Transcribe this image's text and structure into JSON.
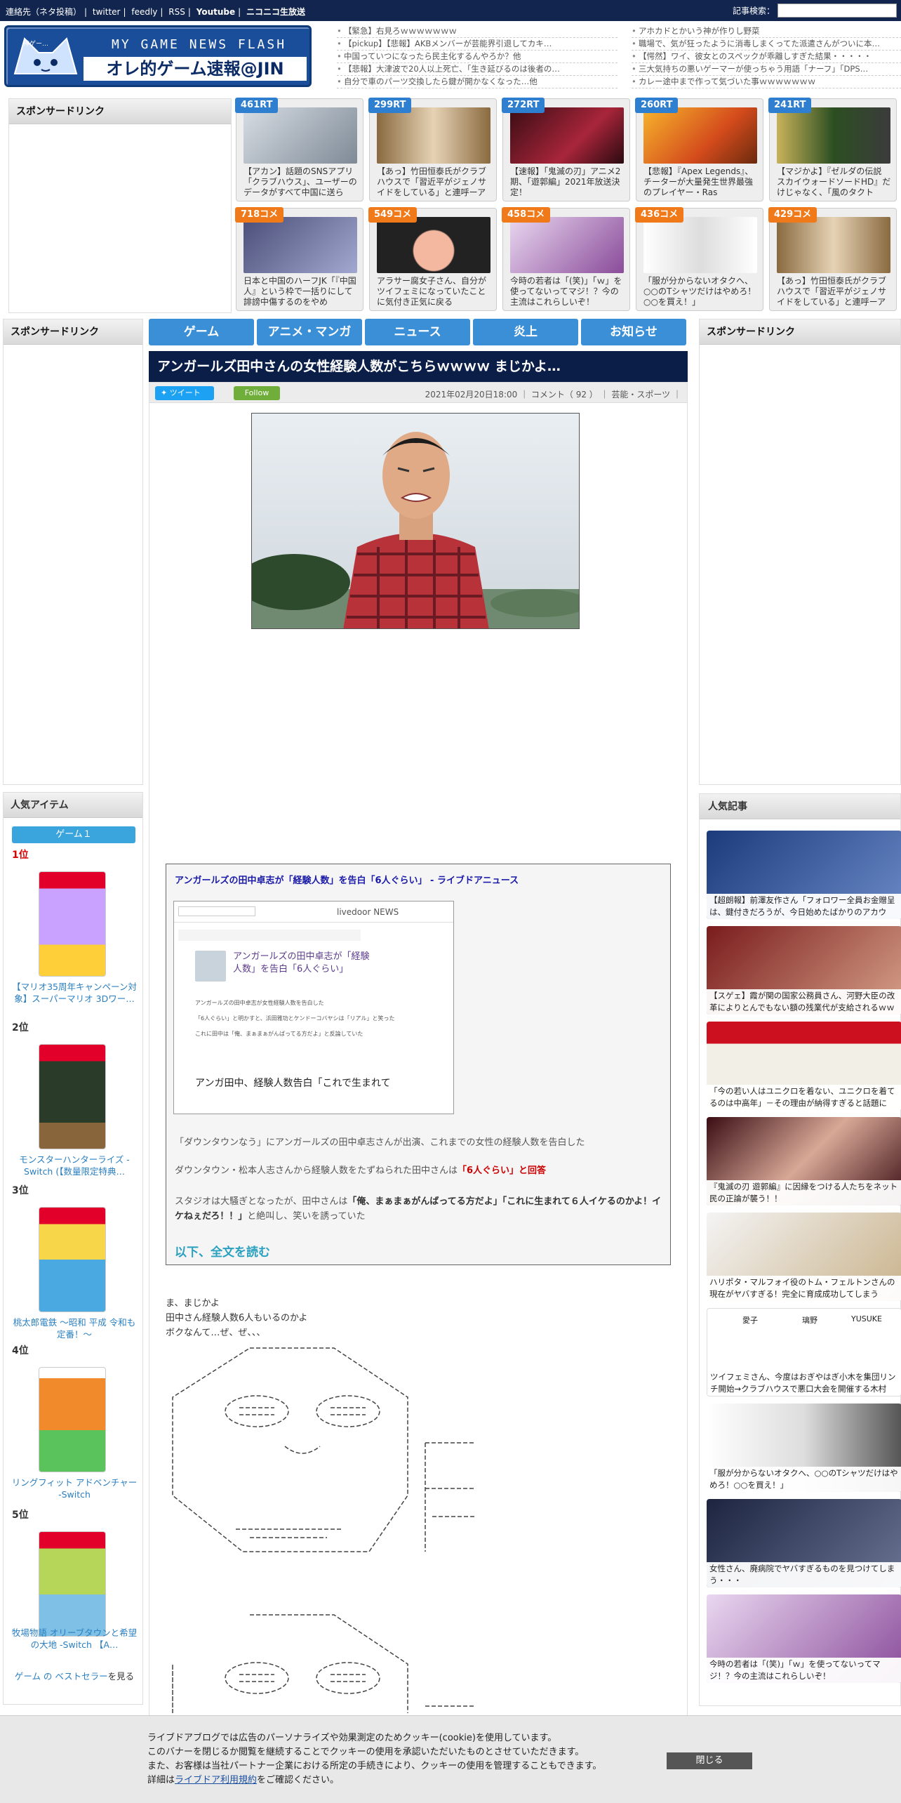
{
  "topbar": {
    "links": [
      "連絡先（ネタ投稿）",
      "|",
      "twitter",
      "|",
      "feedly",
      "|",
      "RSS",
      "|",
      "Youtube",
      "|",
      "ニコニコ生放送"
    ],
    "search_label": "記事検索："
  },
  "logo": {
    "line1": "MY GAME NEWS FLASH",
    "line2": "オレ的ゲーム速報@JIN",
    "mascot_text": "神ゲー…"
  },
  "headlines_left": [
    "【緊急】右見ろｗｗｗｗｗｗｗ",
    "【pickup】【悲報】AKBメンバーが芸能界引退してカキ…",
    "中国っていつになったら民主化するんやろか？他",
    "【悲報】大津波で20人以上死亡、「生き延びるのは後者の…",
    "自分で車のパーツ交換したら鍵が開かなくなった…他"
  ],
  "headlines_right": [
    "アホカドとかいう神が作りし野菜",
    "職場で、気が狂ったように消毒しまくってた派遣さんがついに本…",
    "【愕然】ワイ、彼女とのスペックが乖離しすぎた結果・・・・・",
    "三大気持ちの悪いゲーマーが使っちゃう用語「ナーフ」「DPS…",
    "カレー途中まで作って気づいた事ｗｗｗｗｗｗｗ"
  ],
  "sponsor_label": "スポンサードリンク",
  "rt_cards": [
    {
      "badge": "461RT",
      "text": "【アカン】話題のSNSアプリ「クラブハウス」、ユーザーのデータがすべて中国に送ら"
    },
    {
      "badge": "299RT",
      "text": "【あっ】竹田恒泰氏がクラブハウスで「習近平がジェノサイドをしている」と連呼ーア"
    },
    {
      "badge": "272RT",
      "text": "【速報】「鬼滅の刃」アニメ2期、「遊郭編」2021年放送決定！"
    },
    {
      "badge": "260RT",
      "text": "【悲報】『Apex Legends』、チーターが大量発生世界最強のプレイヤー・Ras"
    },
    {
      "badge": "241RT",
      "text": "【マジかよ】『ゼルダの伝説 スカイウォードソードHD』だけじゃなく、「風のタクト"
    },
    {
      "badge": "718コメ",
      "text": "日本と中国のハーフJK「『中国人』という枠で一括りにして誹謗中傷するのをやめ"
    },
    {
      "badge": "549コメ",
      "text": "アラサー腐女子さん、自分がツイフェミになっていたことに気付き正気に戻る"
    },
    {
      "badge": "458コメ",
      "text": "今時の若者は「(笑)」「ｗ」を使ってないってマジ！？今の主流はこれらしいぞ！"
    },
    {
      "badge": "436コメ",
      "text": "「服が分からないオタクへ、○○のTシャツだけはやめろ！○○を買え！」"
    },
    {
      "badge": "429コメ",
      "text": "【あっ】竹田恒泰氏がクラブハウスで「習近平がジェノサイドをしている」と連呼ーア"
    }
  ],
  "nav": [
    "ゲーム",
    "アニメ・マンガ",
    "ニュース",
    "炎上",
    "お知らせ"
  ],
  "article": {
    "title": "アンガールズ田中さんの女性経験人数がこちらｗｗｗｗ まじかよ…",
    "tweet": "ツイート",
    "follow": "Follow",
    "meta": "2021年02月20日18:00 ｜ コメント（ 92 ） ｜ 芸能・スポーツ ｜"
  },
  "quote": {
    "title": "アンガールズの田中卓志が「経験人数」を告白「6人ぐらい」 - ライブドアニュース",
    "shot_headline": "アンガールズの田中卓志が「経験人数」を告白「6人ぐらい」",
    "shot_brand": "livedoor NEWS",
    "shot_bullets": [
      "アンガールズの田中卓志が女性経験人数を告白した",
      "「6人ぐらい」と明かすと、浜田雅功とケンドーコバヤシは「リアル」と笑った",
      "これに田中は「俺、まぁまぁがんばってる方だよ」と反論していた"
    ],
    "shot_footer": "アンガ田中、経験人数告白「これで生まれて",
    "p1": "「ダウンタウンなう」にアンガールズの田中卓志さんが出演、これまでの女性の経験人数を告白した",
    "p2a": "ダウンタウン・松本人志さんから経験人数をたずねられた田中さんは",
    "p2b": "「6人ぐらい」と回答",
    "p3a": "スタジオは大騒ぎとなったが、田中さんは",
    "p3b": "「俺、まぁまぁがんばってる方だよ」「これに生まれて６人イケるのかよ！イケねぇだろ！！」",
    "p3c": "と絶叫し、笑いを誘っていた",
    "more": "以下、全文を読む"
  },
  "body_lines": [
    "ま、まじかよ",
    "田中さん経験人数6人もいるのかよ",
    "ボクなんて…ぜ、ぜ、、、"
  ],
  "popular_items": {
    "title": "人気アイテム",
    "button": "ゲーム１",
    "ranks": [
      "1位",
      "2位",
      "3位",
      "4位",
      "5位"
    ],
    "products": [
      "【マリオ35周年キャンペーン対象】スーパーマリオ 3Dワー…",
      "モンスターハンターライズ -Switch (【数量限定特典…",
      "桃太郎電鉄 ～昭和 平成 令和も定番！～",
      "リングフィット アドベンチャー -Switch",
      "牧場物語 オリーブタウンと希望の大地 -Switch 【A…"
    ],
    "bestseller_link": "ゲーム の ベストセラー",
    "bestseller_suffix": "を見る"
  },
  "popular_articles": {
    "title": "人気記事",
    "items": [
      "【超朗報】前澤友作さん「フォロワー全員お金贈呈は、鍵付きだろうが、今日始めたばかりのアカウ",
      "【スゲェ】霞が関の国家公務員さん、河野大臣の改革によりとんでもない額の残業代が支給されるｗｗｗ",
      "「今の若い人はユニクロを着ない、ユニクロを着てるのは中高年」－その理由が納得すぎると話題に",
      "『鬼滅の刃 遊郭編』に因縁をつける人たちをネット民の正論が襲う！！",
      "ハリポタ・マルフォイ役のトム・フェルトンさんの現在がヤバすぎる！完全に育成成功してしまう",
      "ツイフェミさん、今度はおぎやはぎ小木を集団リンチ開始→クラブハウスで悪口大会を開催する木村",
      "「服が分からないオタクへ、○○のTシャツだけはやめろ！○○を買え！」",
      "女性さん、廃病院でヤバすぎるものを見つけてしまう・・・",
      "今時の若者は「(笑)」「ｗ」を使ってないってマジ！？今の主流はこれらしいぞ！"
    ],
    "name_labels": [
      "愛子",
      "璃野",
      "YUSUKE"
    ]
  },
  "cookie": {
    "l1": "ライブドアブログでは広告のパーソナライズや効果測定のためクッキー(cookie)を使用しています。",
    "l2": "このバナーを閉じるか閲覧を継続することでクッキーの使用を承認いただいたものとさせていただきます。",
    "l3": "また、お客様は当社パートナー企業における所定の手続きにより、クッキーの使用を管理することもできます。",
    "l4a": "詳細は",
    "l4link": "ライブドア利用規約",
    "l4b": "をご確認ください。",
    "close": "閉じる"
  }
}
